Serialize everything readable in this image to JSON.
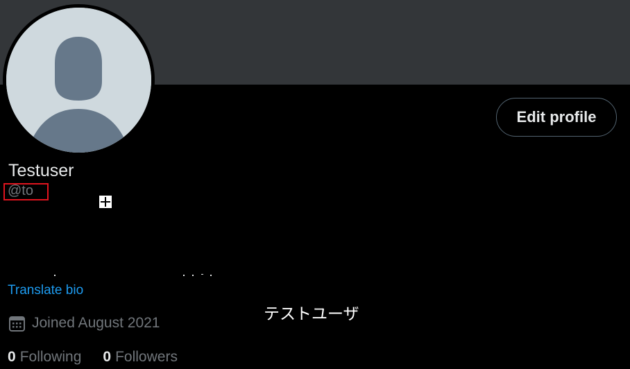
{
  "profile": {
    "display_name": "Testuser",
    "handle": "@to",
    "edit_profile_label": "Edit profile",
    "translate_bio_label": "Translate bio",
    "joined_text": "Joined August 2021",
    "following_count": "0",
    "following_label": "Following",
    "followers_count": "0",
    "followers_label": "Followers"
  },
  "overlay": {
    "text": "テストユーザ"
  },
  "icons": {
    "avatar": "default-avatar-icon",
    "calendar": "calendar-icon",
    "cursor": "crosshair-cursor-icon"
  },
  "colors": {
    "background": "#000000",
    "banner": "#333639",
    "avatar_bg": "#cfd9de",
    "avatar_figure": "#66788a",
    "primary_text": "#e7e9ea",
    "secondary_text": "#71767b",
    "link": "#1d9bf0",
    "highlight_border": "#e0141e",
    "button_border": "#536471"
  }
}
